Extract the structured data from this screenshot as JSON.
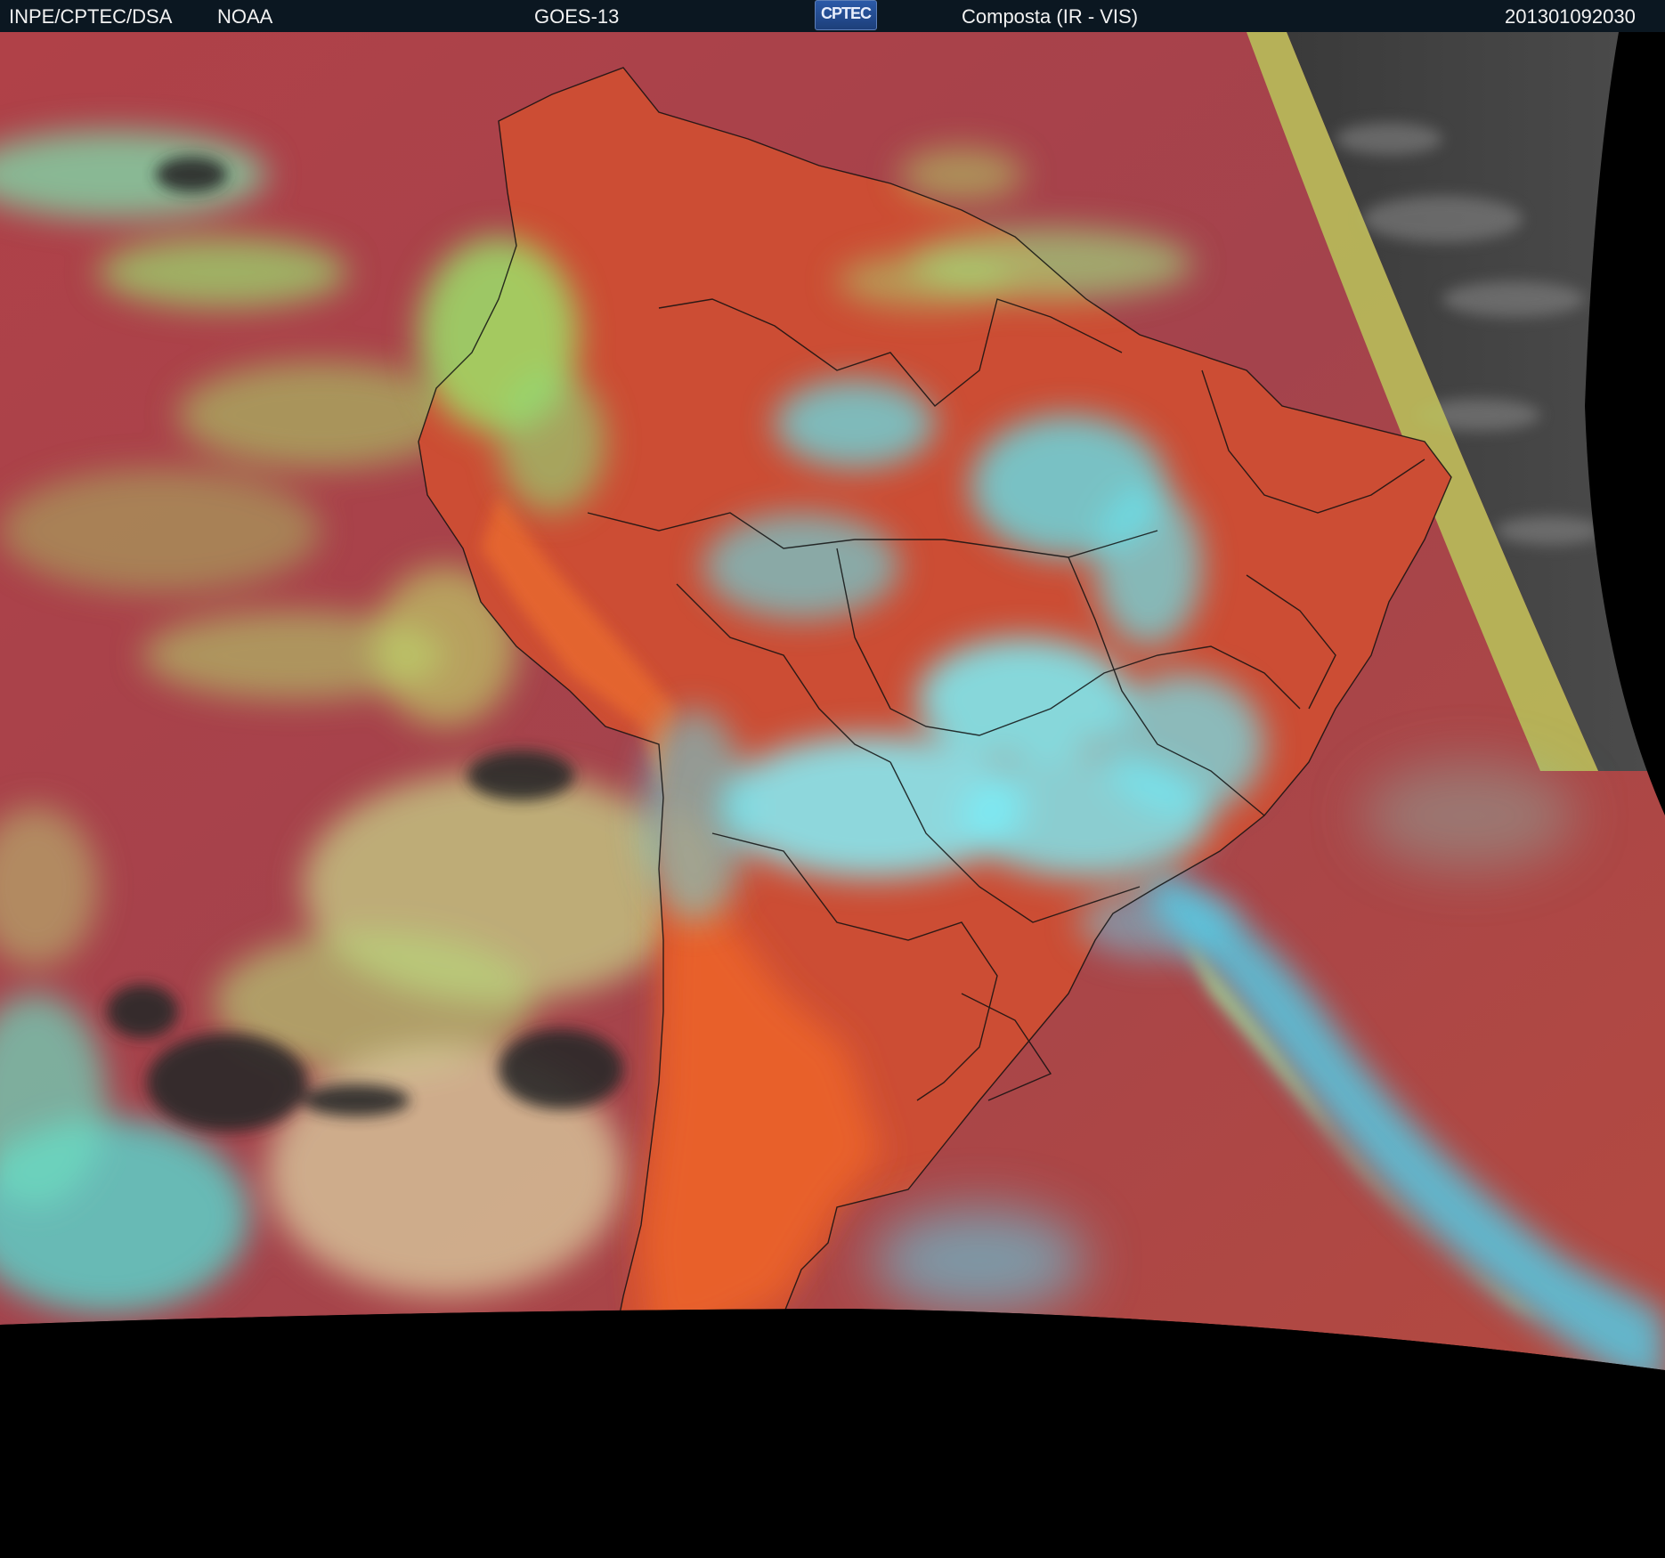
{
  "header": {
    "source": "INPE/CPTEC/DSA",
    "agency": "NOAA",
    "satellite": "GOES-13",
    "logo": "CPTEC",
    "product": "Composta (IR - VIS)",
    "timestamp": "201301092030"
  },
  "colors": {
    "header_bg": "#0b1721",
    "land_orange": "#d8552c",
    "ocean_red": "#a8434a",
    "cloud_green": "#9cec6a",
    "cloud_cyan": "#5ee8f4",
    "vis_gray": "#4a4a4a",
    "space": "#000000"
  }
}
